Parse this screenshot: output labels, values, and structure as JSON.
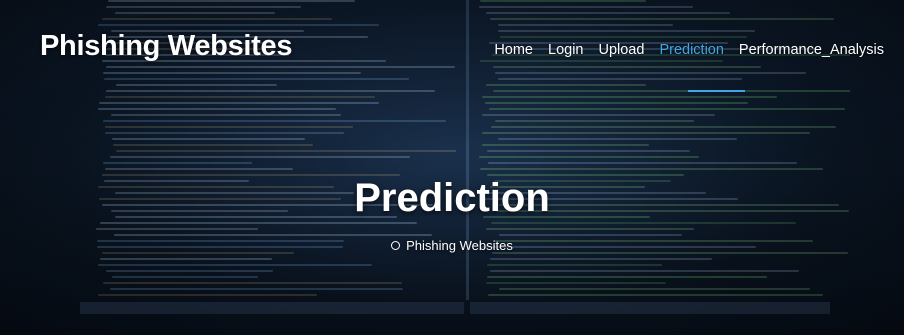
{
  "header": {
    "brand": "Phishing Websites"
  },
  "nav": {
    "items": [
      {
        "label": "Home",
        "active": false
      },
      {
        "label": "Login",
        "active": false
      },
      {
        "label": "Upload",
        "active": false
      },
      {
        "label": "Prediction",
        "active": true
      },
      {
        "label": "Performance_Analysis",
        "active": false
      }
    ]
  },
  "hero": {
    "title": "Prediction",
    "breadcrumb": "Phishing Websites"
  },
  "colors": {
    "accent": "#3fa7e6",
    "text": "#ffffff"
  }
}
